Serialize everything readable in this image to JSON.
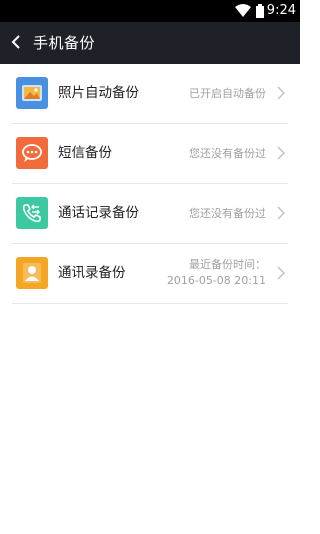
{
  "status_bar": {
    "time": "9:24",
    "icons": [
      "wifi-icon",
      "battery-icon"
    ]
  },
  "app_bar": {
    "back_icon": "back-chevron-icon",
    "title": "手机备份"
  },
  "colors": {
    "app_bar_bg": "#1e2228",
    "photo_icon": "#4a90e2",
    "sms_icon": "#f26b3a",
    "call_log_icon": "#3cc8a0",
    "contacts_icon": "#f5a623"
  },
  "items": [
    {
      "icon": "photo-icon",
      "label": "照片自动备份",
      "status": "已开启自动备份"
    },
    {
      "icon": "message-icon",
      "label": "短信备份",
      "status": "您还没有备份过"
    },
    {
      "icon": "phone-log-icon",
      "label": "通话记录备份",
      "status": "您还没有备份过"
    },
    {
      "icon": "contact-icon",
      "label": "通讯录备份",
      "status_line1": "最近备份时间：",
      "status_line2": "2016-05-08 20:11"
    }
  ]
}
